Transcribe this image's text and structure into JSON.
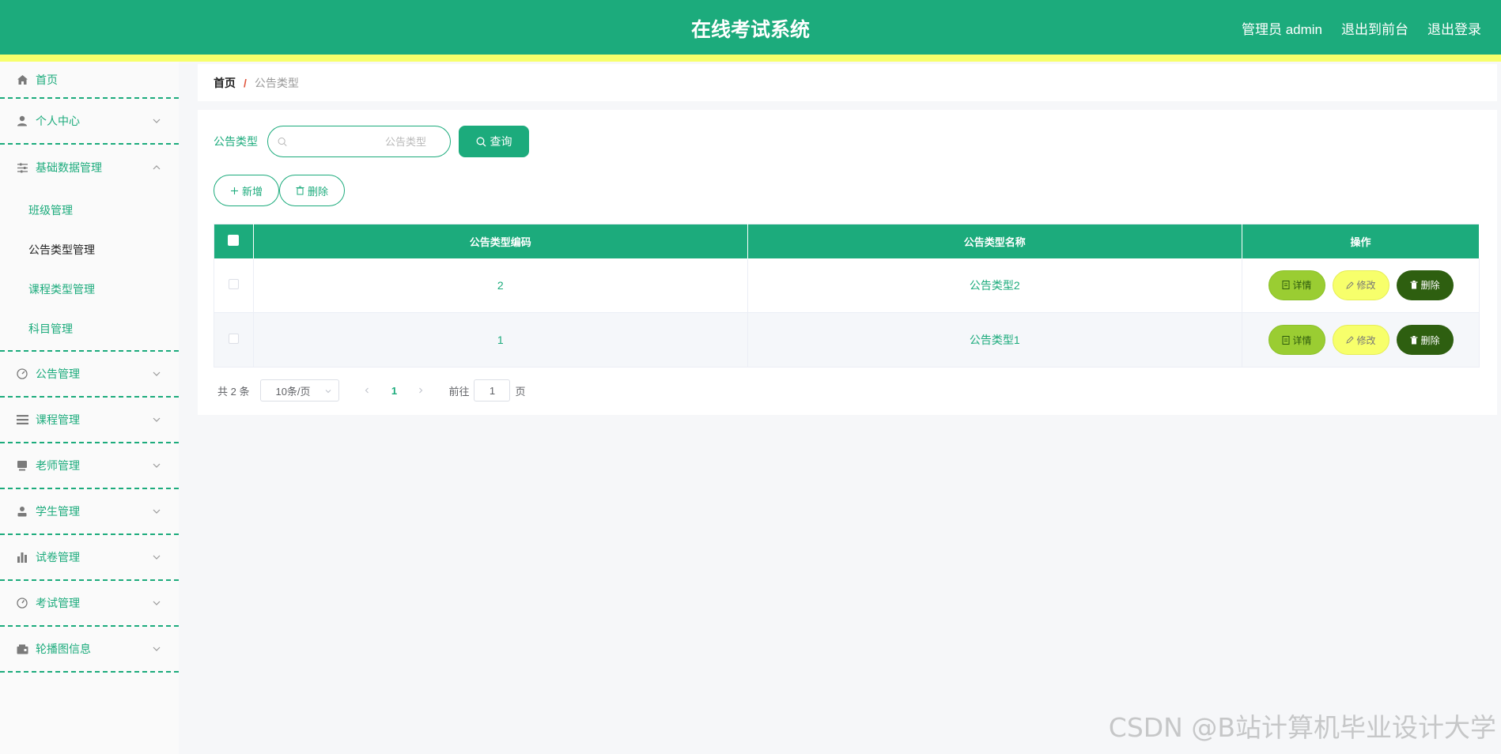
{
  "header": {
    "title": "在线考试系统",
    "user_label": "管理员 admin",
    "frontend_link": "退出到前台",
    "logout_link": "退出登录"
  },
  "sidebar": {
    "items": [
      {
        "label": "首页",
        "icon": "home-icon"
      },
      {
        "label": "个人中心",
        "icon": "user-icon"
      },
      {
        "label": "基础数据管理",
        "icon": "sliders-icon"
      },
      {
        "label": "公告管理",
        "icon": "dashboard-icon"
      },
      {
        "label": "课程管理",
        "icon": "list-icon"
      },
      {
        "label": "老师管理",
        "icon": "monitor-icon"
      },
      {
        "label": "学生管理",
        "icon": "person-icon"
      },
      {
        "label": "试卷管理",
        "icon": "bar-chart-icon"
      },
      {
        "label": "考试管理",
        "icon": "clock-icon"
      },
      {
        "label": "轮播图信息",
        "icon": "wallet-icon"
      }
    ],
    "submenu": [
      {
        "label": "班级管理"
      },
      {
        "label": "公告类型管理"
      },
      {
        "label": "课程类型管理"
      },
      {
        "label": "科目管理"
      }
    ]
  },
  "breadcrumb": {
    "home": "首页",
    "separator": "/",
    "current": "公告类型"
  },
  "search": {
    "label": "公告类型",
    "placeholder": "公告类型",
    "button_label": "查询"
  },
  "actions": {
    "add_label": "新增",
    "delete_label": "删除"
  },
  "table": {
    "columns": [
      "公告类型编码",
      "公告类型名称",
      "操作"
    ],
    "rows": [
      {
        "code": "2",
        "name": "公告类型2"
      },
      {
        "code": "1",
        "name": "公告类型1"
      }
    ],
    "op_detail": "详情",
    "op_edit": "修改",
    "op_delete": "删除"
  },
  "pagination": {
    "total": "共 2 条",
    "page_size": "10条/页",
    "current_page": "1",
    "goto_label": "前往",
    "goto_value": "1",
    "page_suffix": "页"
  },
  "watermark": "CSDN @B站计算机毕业设计大学",
  "colors": {
    "primary": "#1cab7c",
    "accent_yellow": "#f7ff6b",
    "detail_green": "#9acd32",
    "delete_dark_green": "#2e5f10"
  }
}
